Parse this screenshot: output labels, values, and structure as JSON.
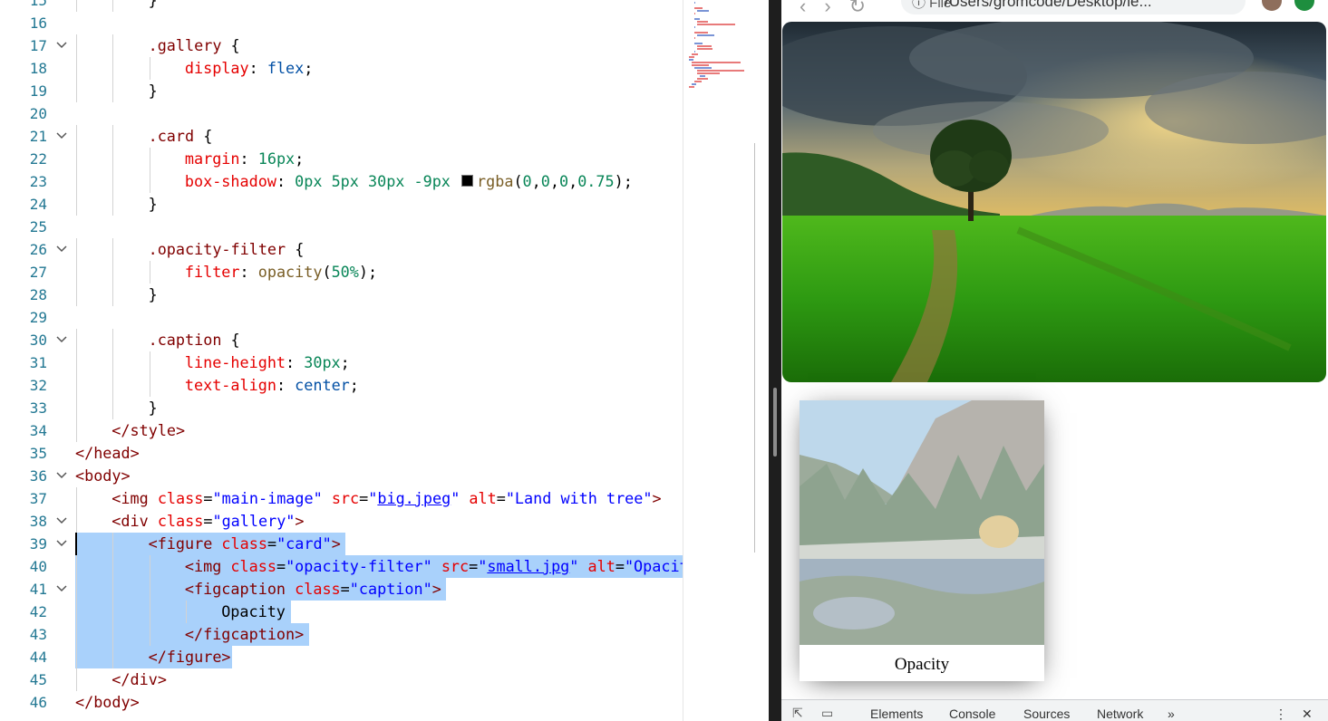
{
  "editor": {
    "lines": [
      {
        "n": "15",
        "fold": false,
        "indent": 2,
        "tokens": [
          [
            "p",
            "}"
          ]
        ]
      },
      {
        "n": "16",
        "fold": false,
        "indent": 0,
        "tokens": []
      },
      {
        "n": "17",
        "fold": true,
        "indent": 2,
        "tokens": [
          [
            "sel",
            ".gallery"
          ],
          [
            "p",
            " {"
          ]
        ]
      },
      {
        "n": "18",
        "fold": false,
        "indent": 3,
        "tokens": [
          [
            "prop",
            "display"
          ],
          [
            "p",
            ": "
          ],
          [
            "val",
            "flex"
          ],
          [
            "p",
            ";"
          ]
        ]
      },
      {
        "n": "19",
        "fold": false,
        "indent": 2,
        "tokens": [
          [
            "p",
            "}"
          ]
        ]
      },
      {
        "n": "20",
        "fold": false,
        "indent": 0,
        "tokens": []
      },
      {
        "n": "21",
        "fold": true,
        "indent": 2,
        "tokens": [
          [
            "sel",
            ".card"
          ],
          [
            "p",
            " {"
          ]
        ]
      },
      {
        "n": "22",
        "fold": false,
        "indent": 3,
        "tokens": [
          [
            "prop",
            "margin"
          ],
          [
            "p",
            ": "
          ],
          [
            "num",
            "16px"
          ],
          [
            "p",
            ";"
          ]
        ]
      },
      {
        "n": "23",
        "fold": false,
        "indent": 3,
        "tokens": [
          [
            "prop",
            "box-shadow"
          ],
          [
            "p",
            ": "
          ],
          [
            "num",
            "0px 5px 30px -9px "
          ],
          [
            "swatch",
            ""
          ],
          [
            "fn",
            "rgba"
          ],
          [
            "p",
            "("
          ],
          [
            "num",
            "0"
          ],
          [
            "p",
            ","
          ],
          [
            "num",
            "0"
          ],
          [
            "p",
            ","
          ],
          [
            "num",
            "0"
          ],
          [
            "p",
            ","
          ],
          [
            "num",
            "0.75"
          ],
          [
            "p",
            ");"
          ]
        ]
      },
      {
        "n": "24",
        "fold": false,
        "indent": 2,
        "tokens": [
          [
            "p",
            "}"
          ]
        ]
      },
      {
        "n": "25",
        "fold": false,
        "indent": 0,
        "tokens": []
      },
      {
        "n": "26",
        "fold": true,
        "indent": 2,
        "tokens": [
          [
            "sel",
            ".opacity-filter"
          ],
          [
            "p",
            " {"
          ]
        ]
      },
      {
        "n": "27",
        "fold": false,
        "indent": 3,
        "tokens": [
          [
            "prop",
            "filter"
          ],
          [
            "p",
            ": "
          ],
          [
            "fn",
            "opacity"
          ],
          [
            "p",
            "("
          ],
          [
            "num",
            "50%"
          ],
          [
            "p",
            ");"
          ]
        ]
      },
      {
        "n": "28",
        "fold": false,
        "indent": 2,
        "tokens": [
          [
            "p",
            "}"
          ]
        ]
      },
      {
        "n": "29",
        "fold": false,
        "indent": 0,
        "tokens": []
      },
      {
        "n": "30",
        "fold": true,
        "indent": 2,
        "tokens": [
          [
            "sel",
            ".caption"
          ],
          [
            "p",
            " {"
          ]
        ]
      },
      {
        "n": "31",
        "fold": false,
        "indent": 3,
        "tokens": [
          [
            "prop",
            "line-height"
          ],
          [
            "p",
            ": "
          ],
          [
            "num",
            "30px"
          ],
          [
            "p",
            ";"
          ]
        ]
      },
      {
        "n": "32",
        "fold": false,
        "indent": 3,
        "tokens": [
          [
            "prop",
            "text-align"
          ],
          [
            "p",
            ": "
          ],
          [
            "val",
            "center"
          ],
          [
            "p",
            ";"
          ]
        ]
      },
      {
        "n": "33",
        "fold": false,
        "indent": 2,
        "tokens": [
          [
            "p",
            "}"
          ]
        ]
      },
      {
        "n": "34",
        "fold": false,
        "indent": 1,
        "tokens": [
          [
            "tag",
            "</style>"
          ]
        ]
      },
      {
        "n": "35",
        "fold": false,
        "indent": 0,
        "tokens": [
          [
            "tag",
            "</head>"
          ]
        ]
      },
      {
        "n": "36",
        "fold": true,
        "indent": 0,
        "tokens": [
          [
            "tag",
            "<body>"
          ]
        ]
      },
      {
        "n": "37",
        "fold": false,
        "indent": 1,
        "tokens": [
          [
            "tag",
            "<img "
          ],
          [
            "attr",
            "class"
          ],
          [
            "p",
            "="
          ],
          [
            "str",
            "\"main-image\""
          ],
          [
            "p",
            " "
          ],
          [
            "attr",
            "src"
          ],
          [
            "p",
            "="
          ],
          [
            "str",
            "\""
          ],
          [
            "link",
            "big.jpeg"
          ],
          [
            "str",
            "\""
          ],
          [
            "p",
            " "
          ],
          [
            "attr",
            "alt"
          ],
          [
            "p",
            "="
          ],
          [
            "str",
            "\"Land with tree\""
          ],
          [
            "tag",
            ">"
          ]
        ]
      },
      {
        "n": "38",
        "fold": true,
        "indent": 1,
        "tokens": [
          [
            "tag",
            "<div "
          ],
          [
            "attr",
            "class"
          ],
          [
            "p",
            "="
          ],
          [
            "str",
            "\"gallery\""
          ],
          [
            "tag",
            ">"
          ]
        ]
      },
      {
        "n": "39",
        "fold": true,
        "indent": 2,
        "tokens": [
          [
            "tag",
            "<figure "
          ],
          [
            "attr",
            "class"
          ],
          [
            "p",
            "="
          ],
          [
            "str",
            "\"card\""
          ],
          [
            "tag",
            ">"
          ]
        ]
      },
      {
        "n": "40",
        "fold": false,
        "indent": 3,
        "tokens": [
          [
            "tag",
            "<img "
          ],
          [
            "attr",
            "class"
          ],
          [
            "p",
            "="
          ],
          [
            "str",
            "\"opacity-filter\""
          ],
          [
            "p",
            " "
          ],
          [
            "attr",
            "src"
          ],
          [
            "p",
            "="
          ],
          [
            "str",
            "\""
          ],
          [
            "link",
            "small.jpg"
          ],
          [
            "str",
            "\""
          ],
          [
            "p",
            " "
          ],
          [
            "attr",
            "alt"
          ],
          [
            "p",
            "="
          ],
          [
            "str",
            "\"Opacity\""
          ],
          [
            "tag",
            ">"
          ]
        ]
      },
      {
        "n": "41",
        "fold": true,
        "indent": 3,
        "tokens": [
          [
            "tag",
            "<figcaption "
          ],
          [
            "attr",
            "class"
          ],
          [
            "p",
            "="
          ],
          [
            "str",
            "\"caption\""
          ],
          [
            "tag",
            ">"
          ]
        ]
      },
      {
        "n": "42",
        "fold": false,
        "indent": 4,
        "tokens": [
          [
            "p",
            "Opacity"
          ]
        ]
      },
      {
        "n": "43",
        "fold": false,
        "indent": 3,
        "tokens": [
          [
            "tag",
            "</figcaption>"
          ]
        ]
      },
      {
        "n": "44",
        "fold": false,
        "indent": 2,
        "tokens": [
          [
            "tag",
            "</figure>"
          ]
        ]
      },
      {
        "n": "45",
        "fold": false,
        "indent": 1,
        "tokens": [
          [
            "tag",
            "</div>"
          ]
        ]
      },
      {
        "n": "46",
        "fold": false,
        "indent": 0,
        "tokens": [
          [
            "tag",
            "</body>"
          ]
        ]
      }
    ],
    "selected_lines": [
      "39",
      "40",
      "41",
      "42",
      "43",
      "44"
    ]
  },
  "browser": {
    "omnibox": {
      "info_label": "File",
      "url": "/Users/gromcode/Desktop/le..."
    },
    "main_image_alt": "Land with tree",
    "card": {
      "image_alt": "Opacity",
      "caption": "Opacity"
    },
    "devtools": {
      "tabs": [
        "Elements",
        "Console",
        "Sources",
        "Network"
      ],
      "more": "»",
      "menu": "⋮",
      "close": "✕"
    }
  },
  "colors": {
    "selection": "#a9d1fb",
    "line_number": "#237893"
  }
}
